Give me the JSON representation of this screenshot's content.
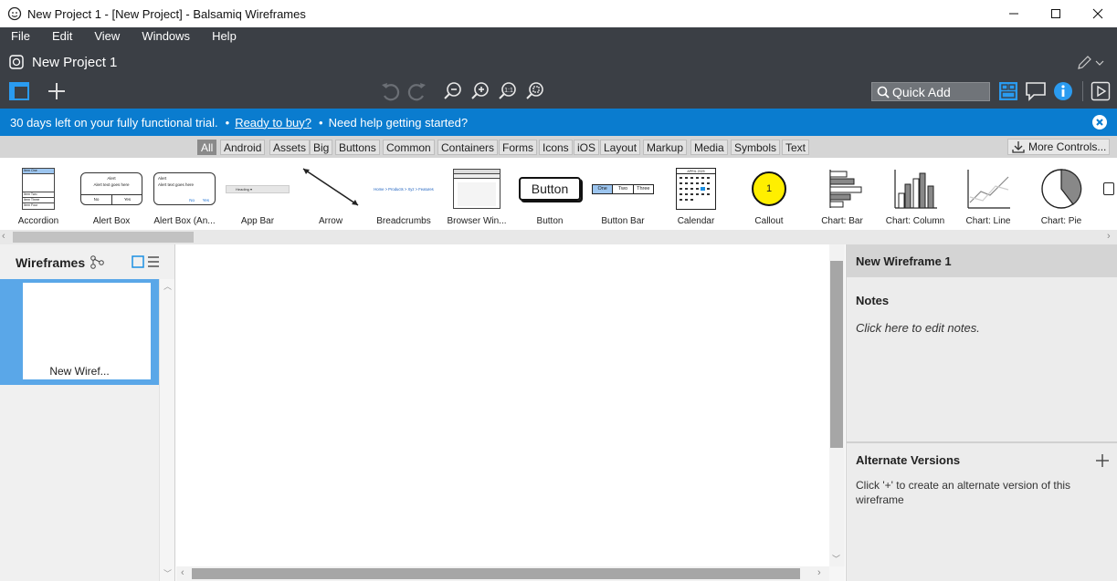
{
  "window": {
    "title": "New Project 1 - [New Project] - Balsamiq Wireframes"
  },
  "menu": [
    "File",
    "Edit",
    "View",
    "Windows",
    "Help"
  ],
  "project": {
    "name": "New Project 1"
  },
  "toolbar": {
    "quick_add_placeholder": "Quick Add"
  },
  "trial": {
    "message": "30 days left on your fully functional trial.",
    "sep1": "•",
    "buy_link": "Ready to buy?",
    "sep2": "•",
    "help_text": "Need help getting started?"
  },
  "categories": [
    "All",
    "Android",
    "Assets",
    "Big",
    "Buttons",
    "Common",
    "Containers",
    "Forms",
    "Icons",
    "iOS",
    "Layout",
    "Markup",
    "Media",
    "Symbols",
    "Text"
  ],
  "selected_category": "All",
  "more_controls": "More Controls...",
  "library": [
    {
      "label": "Accordion",
      "icon": "accordion-thumbnail"
    },
    {
      "label": "Alert Box",
      "icon": "alert-box-thumbnail"
    },
    {
      "label": "Alert Box (An...",
      "icon": "alert-box-android-thumbnail"
    },
    {
      "label": "App Bar",
      "icon": "app-bar-thumbnail"
    },
    {
      "label": "Arrow",
      "icon": "arrow-thumbnail"
    },
    {
      "label": "Breadcrumbs",
      "icon": "breadcrumbs-thumbnail"
    },
    {
      "label": "Browser Win...",
      "icon": "browser-window-thumbnail"
    },
    {
      "label": "Button",
      "icon": "button-thumbnail"
    },
    {
      "label": "Button Bar",
      "icon": "button-bar-thumbnail"
    },
    {
      "label": "Calendar",
      "icon": "calendar-thumbnail"
    },
    {
      "label": "Callout",
      "icon": "callout-thumbnail"
    },
    {
      "label": "Chart: Bar",
      "icon": "chart-bar-thumbnail"
    },
    {
      "label": "Chart: Column",
      "icon": "chart-column-thumbnail"
    },
    {
      "label": "Chart: Line",
      "icon": "chart-line-thumbnail"
    },
    {
      "label": "Chart: Pie",
      "icon": "chart-pie-thumbnail"
    }
  ],
  "thumbs": {
    "accordion_items": [
      "Item One",
      "Item Two",
      "Item Three",
      "Item Four"
    ],
    "alert_title": "Alert",
    "alert_text": "Alert text goes here",
    "alert_no": "No",
    "alert_yes": "Yes",
    "appbar_text": "Heading ▾",
    "breadcrumbs_text": "Home > Products > Xyz > Features",
    "button_text": "Button",
    "buttonbar_items": [
      "One",
      "Two",
      "Three"
    ],
    "calendar_header": "APRIL 2025",
    "callout_number": "1"
  },
  "left_panel": {
    "title": "Wireframes",
    "wireframe_label": "New Wiref..."
  },
  "right_panel": {
    "wireframe_title": "New Wireframe 1",
    "notes_heading": "Notes",
    "notes_placeholder": "Click here to edit notes.",
    "alt_heading": "Alternate Versions",
    "alt_text": "Click '+' to create an alternate version of this wireframe"
  },
  "colors": {
    "dark_bar": "#3b3f45",
    "trial_bar": "#0a7ccf",
    "accent": "#1a8fe3",
    "selected_thumb": "#5aa7e8"
  }
}
